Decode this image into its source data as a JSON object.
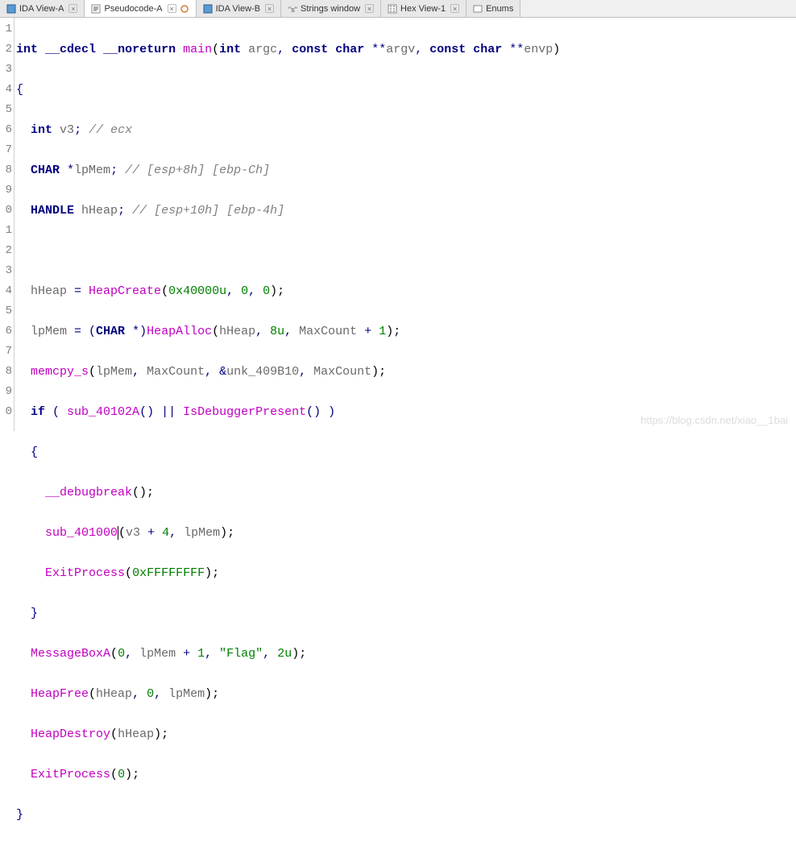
{
  "tabs": [
    {
      "label": "IDA View-A",
      "active": false
    },
    {
      "label": "Pseudocode-A",
      "active": true
    },
    {
      "label": "IDA View-B",
      "active": false
    },
    {
      "label": "Strings window",
      "active": false
    },
    {
      "label": "Hex View-1",
      "active": false
    },
    {
      "label": "Enums",
      "active": false
    }
  ],
  "line_numbers": [
    "1",
    "2",
    "3",
    "4",
    "5",
    "6",
    "7",
    "8",
    "9",
    "0",
    "1",
    "2",
    "3",
    "4",
    "5",
    "6",
    "7",
    "8",
    "9",
    "0"
  ],
  "code": {
    "l1": {
      "kw1": "int",
      "kw2": "__cdecl",
      "kw3": "__noreturn",
      "fn": "main",
      "sig_open": "(",
      "arg1_kw": "int",
      "arg1_name": "argc",
      "c1": ", ",
      "arg2_kw": "const char",
      "arg2_ptr": " **",
      "arg2_name": "argv",
      "c2": ", ",
      "arg3_kw": "const char",
      "arg3_ptr": " **",
      "arg3_name": "envp",
      "sig_close": ")"
    },
    "l2": {
      "text": "{"
    },
    "l3": {
      "indent": "  ",
      "kw": "int",
      "sp": " ",
      "name": "v3",
      "semi": "; ",
      "comment": "// ecx"
    },
    "l4": {
      "indent": "  ",
      "kw": "CHAR",
      "sp": " *",
      "name": "lpMem",
      "semi": "; ",
      "comment": "// [esp+8h] [ebp-Ch]"
    },
    "l5": {
      "indent": "  ",
      "kw": "HANDLE",
      "sp": " ",
      "name": "hHeap",
      "semi": "; ",
      "comment": "// [esp+10h] [ebp-4h]"
    },
    "l6": {
      "text": ""
    },
    "l7": {
      "indent": "  ",
      "lhs": "hHeap",
      "eq": " = ",
      "fn": "HeapCreate",
      "open": "(",
      "arg1": "0x40000u",
      "c1": ", ",
      "arg2": "0",
      "c2": ", ",
      "arg3": "0",
      "close": ");"
    },
    "l8": {
      "indent": "  ",
      "lhs": "lpMem",
      "eq": " = (",
      "cast": "CHAR",
      "castp": " *)",
      "fn": "HeapAlloc",
      "open": "(",
      "arg1": "hHeap",
      "c1": ", ",
      "arg2": "8u",
      "c2": ", ",
      "arg3": "MaxCount",
      "plus": " + ",
      "arg4": "1",
      "close": ");"
    },
    "l9": {
      "indent": "  ",
      "fn": "memcpy_s",
      "open": "(",
      "arg1": "lpMem",
      "c1": ", ",
      "arg2": "MaxCount",
      "c2": ", &",
      "arg3": "unk_409B10",
      "c3": ", ",
      "arg4": "MaxCount",
      "close": ");"
    },
    "l10": {
      "indent": "  ",
      "kw": "if",
      "sp": " ( ",
      "fn1": "sub_40102A",
      "p1": "() || ",
      "fn2": "IsDebuggerPresent",
      "p2": "() )"
    },
    "l11": {
      "indent": "  ",
      "text": "{"
    },
    "l12": {
      "indent": "    ",
      "fn": "__debugbreak",
      "close": "();"
    },
    "l13": {
      "indent": "    ",
      "fn": "sub_401000",
      "open": "(",
      "arg1": "v3",
      "plus": " + ",
      "arg2": "4",
      "c1": ", ",
      "arg3": "lpMem",
      "close": ");"
    },
    "l14": {
      "indent": "    ",
      "fn": "ExitProcess",
      "open": "(",
      "arg1": "0xFFFFFFFF",
      "close": ");"
    },
    "l15": {
      "indent": "  ",
      "text": "}"
    },
    "l16": {
      "indent": "  ",
      "fn": "MessageBoxA",
      "open": "(",
      "arg1": "0",
      "c1": ", ",
      "arg2": "lpMem",
      "plus": " + ",
      "arg3": "1",
      "c2": ", ",
      "str": "\"Flag\"",
      "c3": ", ",
      "arg4": "2u",
      "close": ");"
    },
    "l17": {
      "indent": "  ",
      "fn": "HeapFree",
      "open": "(",
      "arg1": "hHeap",
      "c1": ", ",
      "arg2": "0",
      "c2": ", ",
      "arg3": "lpMem",
      "close": ");"
    },
    "l18": {
      "indent": "  ",
      "fn": "HeapDestroy",
      "open": "(",
      "arg1": "hHeap",
      "close": ");"
    },
    "l19": {
      "indent": "  ",
      "fn": "ExitProcess",
      "open": "(",
      "arg1": "0",
      "close": ");"
    },
    "l20": {
      "text": "}"
    }
  },
  "watermark": "https://blog.csdn.net/xiao__1bai"
}
